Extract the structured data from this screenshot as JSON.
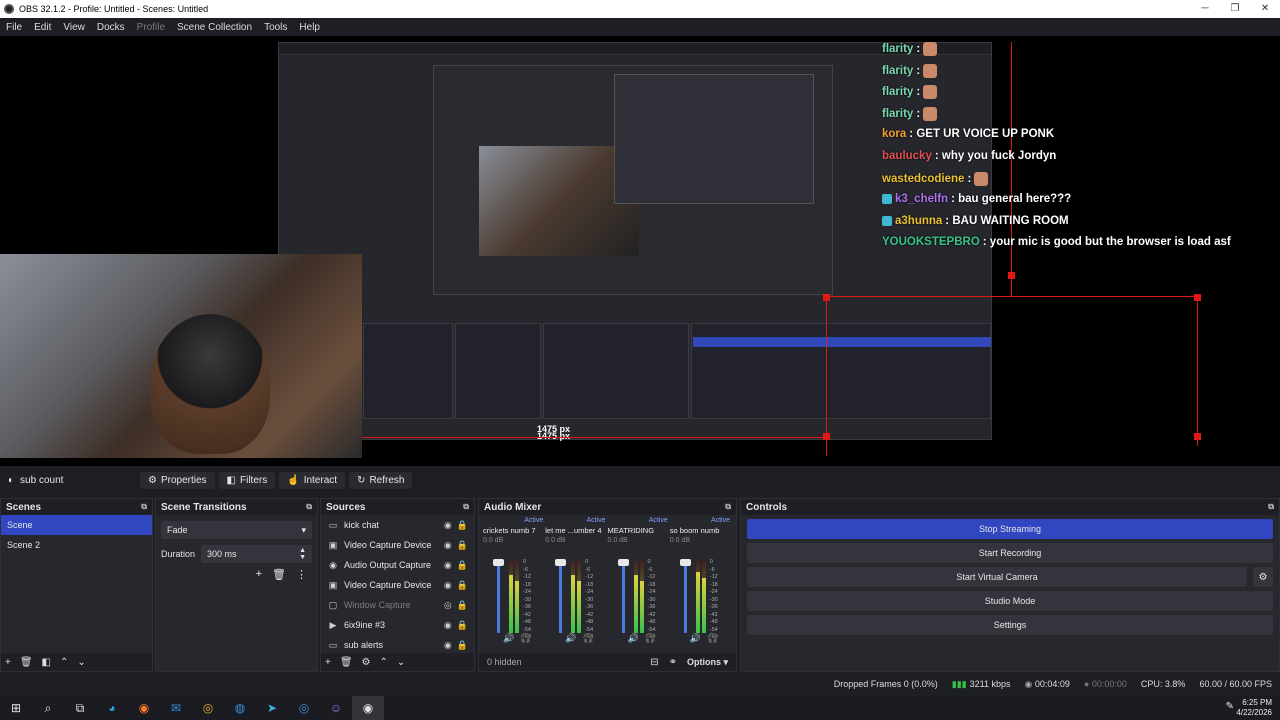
{
  "window": {
    "title": "OBS 32.1.2 - Profile: Untitled - Scenes: Untitled",
    "minimize": "─",
    "restore": "❐",
    "close": "✕"
  },
  "menu": {
    "file": "File",
    "edit": "Edit",
    "view": "View",
    "docks": "Docks",
    "profile": "Profile",
    "scene_collection": "Scene Collection",
    "tools": "Tools",
    "help": "Help"
  },
  "preview": {
    "px_label_main": "1475 px",
    "px_label_nested": "1475 px"
  },
  "chat": [
    {
      "user": "flarity",
      "color": "#78d8b0",
      "text": "",
      "emote": true
    },
    {
      "user": "flarity",
      "color": "#78d8b0",
      "text": "",
      "emote": true
    },
    {
      "user": "flarity",
      "color": "#78d8b0",
      "text": "",
      "emote": true
    },
    {
      "user": "flarity",
      "color": "#78d8b0",
      "text": "",
      "emote": true
    },
    {
      "user": "kora",
      "color": "#f0a030",
      "text": "GET UR VOICE UP PONK"
    },
    {
      "user": "baulucky",
      "color": "#e05050",
      "text": "why you fuck Jordyn"
    },
    {
      "user": "wastedcodiene",
      "color": "#e8c030",
      "text": "",
      "emote": true
    },
    {
      "user": "k3_chelfn",
      "color": "#b070f0",
      "text": "bau general here???",
      "badge": true
    },
    {
      "user": "a3hunna",
      "color": "#e8c030",
      "text": "BAU WAITING ROOM",
      "badge": true
    },
    {
      "user": "YOUOKSTEPBRO",
      "color": "#38c28a",
      "text": "your mic is good but the browser is load asf"
    }
  ],
  "source_toolbar": {
    "selected_source": "sub count",
    "properties": "Properties",
    "filters": "Filters",
    "interact": "Interact",
    "refresh": "Refresh"
  },
  "scenes": {
    "title": "Scenes",
    "items": [
      "Scene",
      "Scene 2"
    ],
    "active_index": 0
  },
  "transitions": {
    "title": "Scene Transitions",
    "selected": "Fade",
    "duration_label": "Duration",
    "duration_value": "300 ms"
  },
  "sources": {
    "title": "Sources",
    "items": [
      {
        "name": "kick chat",
        "icon": "browser-icon",
        "glyph": "▭",
        "dim": false
      },
      {
        "name": "Video Capture Device",
        "icon": "camera-icon",
        "glyph": "▣",
        "dim": false
      },
      {
        "name": "Audio Output Capture",
        "icon": "speaker-icon",
        "glyph": "◉",
        "dim": false
      },
      {
        "name": "Video Capture Device",
        "icon": "camera-icon",
        "glyph": "▣",
        "dim": false
      },
      {
        "name": "Window Capture",
        "icon": "window-icon",
        "glyph": "▢",
        "dim": true
      },
      {
        "name": "6ix9ine #3",
        "icon": "play-icon",
        "glyph": "▶",
        "dim": false
      },
      {
        "name": "sub alerts",
        "icon": "browser-icon",
        "glyph": "▭",
        "dim": false
      }
    ]
  },
  "mixer": {
    "title": "Audio Mixer",
    "hidden_label": "0 hidden",
    "options_label": "Options",
    "strips": [
      {
        "active": "Active",
        "name": "crickets numb 7",
        "db": "0.0 dB",
        "level": 0.8
      },
      {
        "active": "Active",
        "name": "let me ...umber 4",
        "db": "0.0 dB",
        "level": 0.8
      },
      {
        "active": "Active",
        "name": "MEATRIDING",
        "db": "0.0 dB",
        "level": 0.8
      },
      {
        "active": "Active",
        "name": "so boom numb",
        "db": "0.0 dB",
        "level": 0.85
      }
    ],
    "ticks": [
      "0",
      "-6",
      "-12",
      "-18",
      "-24",
      "-30",
      "-36",
      "-42",
      "-48",
      "-54",
      "-60"
    ]
  },
  "controls": {
    "title": "Controls",
    "stop_streaming": "Stop Streaming",
    "start_recording": "Start Recording",
    "start_virtual_camera": "Start Virtual Camera",
    "studio_mode": "Studio Mode",
    "settings": "Settings"
  },
  "status": {
    "dropped": "Dropped Frames 0 (0.0%)",
    "bitrate": "3211 kbps",
    "stream_time": "00:04:09",
    "rec_time": "00:00:00",
    "cpu": "CPU: 3.8%",
    "fps": "60.00 / 60.00 FPS"
  },
  "taskbar": {
    "time": "6:25 PM",
    "date": "4/22/2026"
  },
  "colors": {
    "accent": "#3047c1",
    "meter_green": "#38c24a",
    "red_guide": "#e01818"
  }
}
